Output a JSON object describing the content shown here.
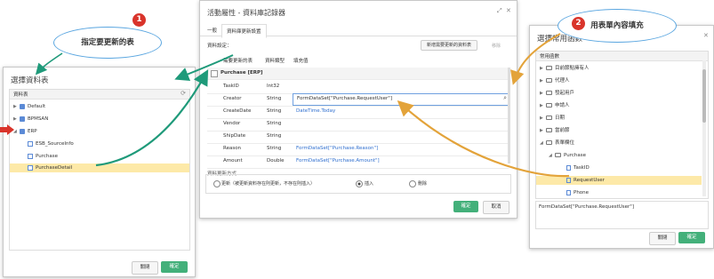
{
  "left_dialog": {
    "title": "選擇資料表",
    "panel_header": "資料表",
    "refresh_icon": "refresh-icon",
    "tree": [
      {
        "label": "Default",
        "type": "database"
      },
      {
        "label": "BPMSAN",
        "type": "database"
      },
      {
        "label": "ERP",
        "type": "database"
      },
      {
        "label": "ESB_SourceInfo",
        "type": "table"
      },
      {
        "label": "Purchase",
        "type": "table"
      },
      {
        "label": "PurchaseDetail",
        "type": "table",
        "selected": true
      }
    ],
    "close_button": "關閉",
    "confirm_button": "確定"
  },
  "middle_dialog": {
    "title": "活動屬性 - 資料庫記錄器",
    "tabs": [
      "一般",
      "資料庫更新設置"
    ],
    "field_label": "資料設定：",
    "add_table_button": "新增需要更新的資料表",
    "remove_button": "移除",
    "columns": [
      "需要更新的表",
      "資料類型",
      "填充值"
    ],
    "table_group": "Purchase [ERP]",
    "rows": [
      {
        "field": "TaskID",
        "type": "Int32",
        "value": ""
      },
      {
        "field": "Creator",
        "type": "String",
        "value": "FormDataSet[\"Purchase.RequestUser\"]"
      },
      {
        "field": "CreateDate",
        "type": "String",
        "value": "DateTime.Today"
      },
      {
        "field": "Vendor",
        "type": "String",
        "value": ""
      },
      {
        "field": "ShipDate",
        "type": "String",
        "value": ""
      },
      {
        "field": "Reason",
        "type": "String",
        "value": "FormDataSet[\"Purchase.Reason\"]"
      },
      {
        "field": "Amount",
        "type": "Double",
        "value": "FormDataSet[\"Purchase.Amount\"]"
      }
    ],
    "update_mode_label": "資料更新方式",
    "update_options": [
      "更新（被更新資料存在則更新，不存在則插入）",
      "插入",
      "刪除"
    ],
    "selected_option_index": 1,
    "confirm_button": "確定",
    "cancel_button": "取消"
  },
  "right_dialog": {
    "title": "選擇常用函數",
    "panel_header": "常用函數",
    "tree": [
      {
        "label": "目前節點擁有人",
        "depth": 0,
        "expanded": false
      },
      {
        "label": "代理人",
        "depth": 0,
        "expanded": false
      },
      {
        "label": "發起用戶",
        "depth": 0,
        "expanded": false
      },
      {
        "label": "申請人",
        "depth": 0,
        "expanded": false
      },
      {
        "label": "日期",
        "depth": 0,
        "expanded": false
      },
      {
        "label": "當前節",
        "depth": 0,
        "expanded": false
      },
      {
        "label": "表單欄位",
        "depth": 0,
        "expanded": true
      },
      {
        "label": "Purchase",
        "depth": 1,
        "expanded": true
      },
      {
        "label": "TaskID",
        "depth": 2
      },
      {
        "label": "RequestUser",
        "depth": 2,
        "selected": true
      },
      {
        "label": "Phone",
        "depth": 2
      }
    ],
    "expression": "FormDataSet[\"Purchase.RequestUser\"]",
    "close_button": "關閉",
    "confirm_button": "確定"
  },
  "annotations": {
    "callout_1": "指定要更新的表",
    "callout_2": "用表單內容填充",
    "badge_1": "1",
    "badge_2": "2"
  },
  "colors": {
    "confirm_green": "#43b07a",
    "selection_yellow": "#fde9a8",
    "link_blue": "#2f6fcf",
    "badge_red": "#d9342b",
    "arrow_teal": "#1f9a7a",
    "arrow_orange": "#e3a33a"
  }
}
